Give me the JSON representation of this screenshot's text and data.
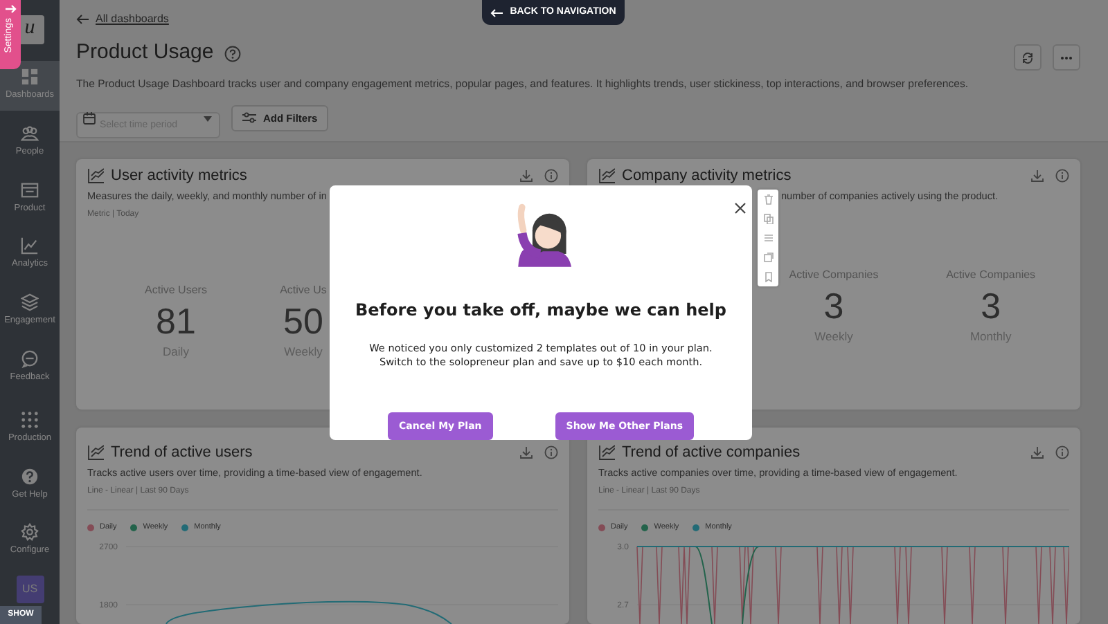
{
  "settings_tab": {
    "label": "Settings"
  },
  "back_button": {
    "label": "BACK TO NAVIGATION"
  },
  "sidebar": {
    "logo": "u",
    "items": [
      {
        "label": "Dashboards",
        "selected": true
      },
      {
        "label": "People",
        "selected": false
      },
      {
        "label": "Product",
        "selected": false
      },
      {
        "label": "Analytics",
        "selected": false
      },
      {
        "label": "Engagement",
        "selected": false
      },
      {
        "label": "Feedback",
        "selected": false
      }
    ],
    "bottom_items": [
      {
        "label": "Production"
      },
      {
        "label": "Get Help"
      },
      {
        "label": "Configure"
      }
    ],
    "avatar": "US"
  },
  "show_button": {
    "label": "SHOW"
  },
  "header": {
    "breadcrumb": "All dashboards",
    "title": "Product Usage",
    "description": "The Product Usage Dashboard tracks user and company engagement metrics, popular pages, and features. It highlights trends, user stickiness, top interactions, and browser preferences.",
    "time_period": {
      "placeholder": "Select time period"
    },
    "filter_button": "Add Filters"
  },
  "metric_cards": [
    {
      "title": "User activity metrics",
      "description": "Measures the daily, weekly, and monthly number of in",
      "meta": "Metric | Today",
      "stats": [
        {
          "label": "Active Users",
          "value": "81",
          "period": "Daily"
        },
        {
          "label": "Active Us",
          "value": "50",
          "period": "Weekly"
        }
      ]
    },
    {
      "title": "Company activity metrics",
      "description": "number of companies actively using the product.",
      "stats": [
        {
          "label": "Active Companies",
          "value": "3",
          "period": "Weekly"
        },
        {
          "label": "Active Companies",
          "value": "3",
          "period": "Monthly"
        }
      ]
    }
  ],
  "trend_cards": [
    {
      "title": "Trend of active users",
      "description": "Tracks active users over time, providing a time-based view of engagement.",
      "meta": "Line - Linear | Last 90 Days",
      "legend": [
        {
          "label": "Daily",
          "color": "#844c56"
        },
        {
          "label": "Weekly",
          "color": "#23634b"
        },
        {
          "label": "Monthly",
          "color": "#236b76"
        }
      ],
      "y_labels": [
        "2700",
        "1800"
      ],
      "kind": "smooth"
    },
    {
      "title": "Trend of active companies",
      "description": "Tracks active companies over time, providing a time-based view of engagement.",
      "meta": "Line - Linear | Last 90 Days",
      "legend": [
        {
          "label": "Daily",
          "color": "#844c56"
        },
        {
          "label": "Weekly",
          "color": "#23634b"
        },
        {
          "label": "Monthly",
          "color": "#236b76"
        }
      ],
      "y_labels": [
        "3.0",
        "2.7"
      ],
      "kind": "spiky"
    }
  ],
  "modal": {
    "title": "Before you take off, maybe we can help",
    "lines": [
      "We noticed you only customized 2 templates out of 10 in your plan.",
      "Switch to the solopreneur plan and save up to $10 each month."
    ],
    "buttons": [
      "Cancel My Plan",
      "Show Me Other Plans"
    ]
  }
}
